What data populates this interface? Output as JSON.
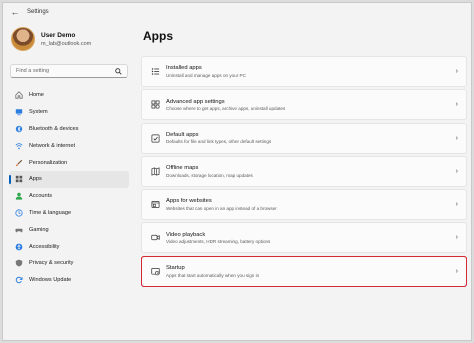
{
  "window": {
    "title": "Settings"
  },
  "user": {
    "name": "User Demo",
    "email": "m_lab@outlook.com"
  },
  "search": {
    "placeholder": "Find a setting"
  },
  "nav": {
    "items": [
      {
        "label": "Home",
        "icon": "home-icon",
        "color": "#6b6b6b"
      },
      {
        "label": "System",
        "icon": "monitor-icon",
        "color": "#2b7de0"
      },
      {
        "label": "Bluetooth & devices",
        "icon": "bluetooth-icon",
        "color": "#2b7de0"
      },
      {
        "label": "Network & internet",
        "icon": "network-icon",
        "color": "#2b7de0"
      },
      {
        "label": "Personalization",
        "icon": "brush-icon",
        "color": "#e06a2b"
      },
      {
        "label": "Apps",
        "icon": "apps-icon",
        "color": "#555555",
        "active": true
      },
      {
        "label": "Accounts",
        "icon": "person-icon",
        "color": "#2fa84f"
      },
      {
        "label": "Time & language",
        "icon": "globe-clock-icon",
        "color": "#2b7de0"
      },
      {
        "label": "Gaming",
        "icon": "gamepad-icon",
        "color": "#777777"
      },
      {
        "label": "Accessibility",
        "icon": "accessibility-icon",
        "color": "#2b7de0"
      },
      {
        "label": "Privacy & security",
        "icon": "shield-icon",
        "color": "#777777"
      },
      {
        "label": "Windows Update",
        "icon": "refresh-icon",
        "color": "#2b7de0"
      }
    ]
  },
  "main": {
    "title": "Apps",
    "cards": [
      {
        "title": "Installed apps",
        "desc": "Uninstall and manage apps on your PC",
        "icon": "list-icon"
      },
      {
        "title": "Advanced app settings",
        "desc": "Choose where to get apps, archive apps, uninstall updates",
        "icon": "app-settings-icon"
      },
      {
        "title": "Default apps",
        "desc": "Defaults for file and link types, other default settings",
        "icon": "default-apps-icon"
      },
      {
        "title": "Offline maps",
        "desc": "Downloads, storage location, map updates",
        "icon": "map-icon"
      },
      {
        "title": "Apps for websites",
        "desc": "Websites that can open in an app instead of a browser",
        "icon": "web-apps-icon"
      },
      {
        "title": "Video playback",
        "desc": "Video adjustments, HDR streaming, battery options",
        "icon": "video-icon"
      },
      {
        "title": "Startup",
        "desc": "Apps that start automatically when you sign in",
        "icon": "startup-icon",
        "highlighted": true
      }
    ]
  },
  "colors": {
    "accent": "#005fb8",
    "highlight": "#d32a33"
  }
}
